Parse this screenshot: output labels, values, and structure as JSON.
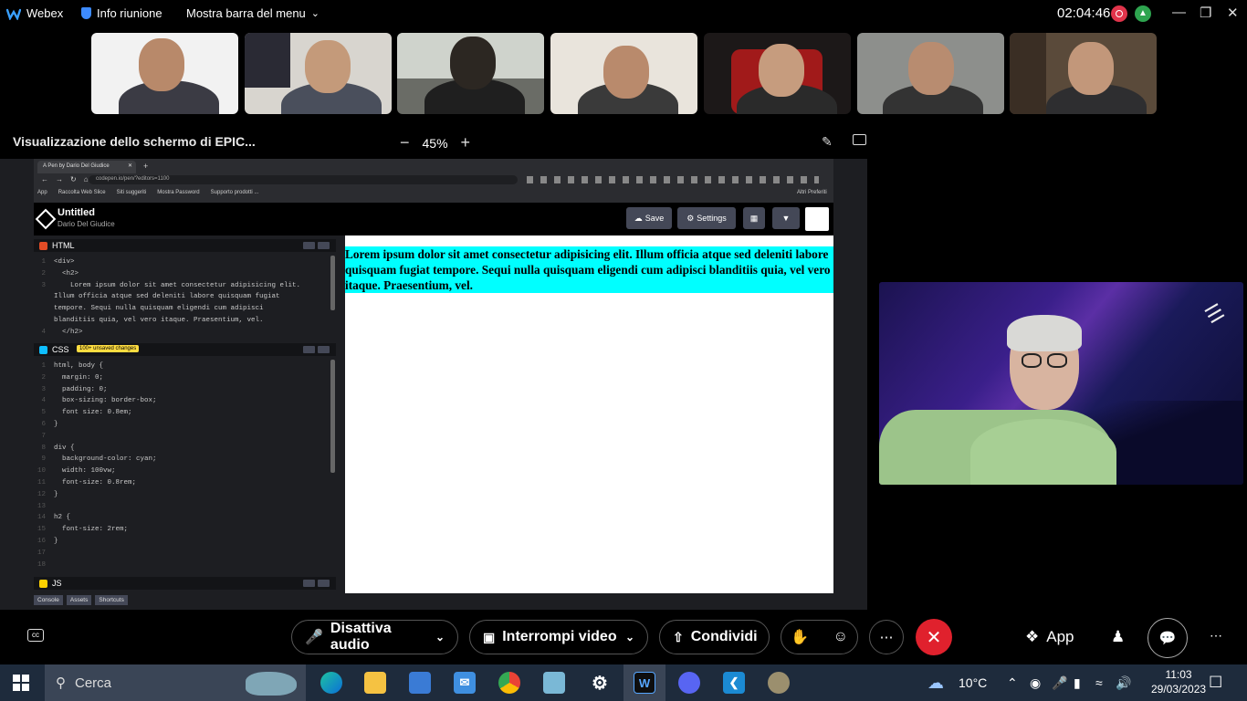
{
  "topbar": {
    "app_name": "Webex",
    "meeting_info": "Info riunione",
    "menu_bar": "Mostra barra del menu",
    "timer": "02:04:46",
    "stats_icon": "chart-icon"
  },
  "share": {
    "title": "Visualizzazione dello schermo di EPIC...",
    "zoom": "45%"
  },
  "browser": {
    "tab_title": "A Pen by Dario Del Giudice",
    "url": "codepen.io/pen/?editors=1100",
    "bookmarks": [
      "App",
      "Raccolta Web Slice",
      "Siti suggeriti",
      "Mostra Password",
      "Supporto prodotti ...",
      "Altri Preferiti"
    ]
  },
  "codepen": {
    "title": "Untitled",
    "author": "Dario Del Giudice",
    "save": "Save",
    "settings": "Settings",
    "html_label": "HTML",
    "css_label": "CSS",
    "js_label": "JS",
    "unsaved_badge": "100+ unsaved changes",
    "bottom_tabs": [
      "Console",
      "Assets",
      "Shortcuts"
    ]
  },
  "html_code": [
    {
      "n": "1",
      "text": "<div>"
    },
    {
      "n": "2",
      "text": "  <h2>"
    },
    {
      "n": "3",
      "text": "    Lorem ipsum dolor sit amet consectetur adipisicing elit."
    },
    {
      "n": "",
      "text": "Illum officia atque sed deleniti labore quisquam fugiat"
    },
    {
      "n": "",
      "text": "tempore. Sequi nulla quisquam eligendi cum adipisci"
    },
    {
      "n": "",
      "text": "blanditiis quia, vel vero itaque. Praesentium, vel."
    },
    {
      "n": "4",
      "text": "  </h2>"
    }
  ],
  "css_code": [
    {
      "n": "1",
      "text": "html, body {"
    },
    {
      "n": "2",
      "text": "  margin: 0;"
    },
    {
      "n": "3",
      "text": "  padding: 0;"
    },
    {
      "n": "4",
      "text": "  box-sizing: border-box;"
    },
    {
      "n": "5",
      "text": "  font size: 0.8em;"
    },
    {
      "n": "6",
      "text": "}"
    },
    {
      "n": "7",
      "text": ""
    },
    {
      "n": "8",
      "text": "div {"
    },
    {
      "n": "9",
      "text": "  background-color: cyan;"
    },
    {
      "n": "10",
      "text": "  width: 100vw;"
    },
    {
      "n": "11",
      "text": "  font-size: 0.8rem;"
    },
    {
      "n": "12",
      "text": "}"
    },
    {
      "n": "13",
      "text": ""
    },
    {
      "n": "14",
      "text": "h2 {"
    },
    {
      "n": "15",
      "text": "  font-size: 2rem;"
    },
    {
      "n": "16",
      "text": "}"
    },
    {
      "n": "17",
      "text": ""
    },
    {
      "n": "18",
      "text": ""
    }
  ],
  "preview": {
    "heading": "Lorem ipsum dolor sit amet consectetur adipisicing elit. Illum officia atque sed deleniti labore quisquam fugiat tempore. Sequi nulla quisquam eligendi cum adipisci blanditiis quia, vel vero itaque. Praesentium, vel.",
    "bg_color": "#00ffff"
  },
  "controls": {
    "mute": "Disattiva audio",
    "video": "Interrompi video",
    "share": "Condividi",
    "apps": "App"
  },
  "taskbar": {
    "search_placeholder": "Cerca",
    "weather": "10°C",
    "time": "11:03",
    "date": "29/03/2023"
  }
}
